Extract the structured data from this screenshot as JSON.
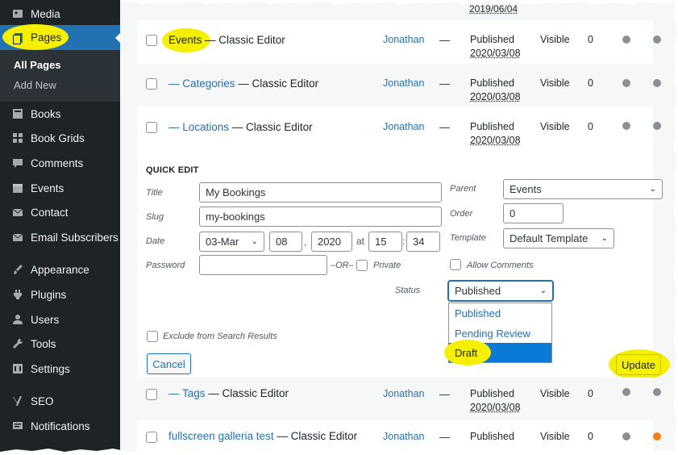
{
  "sidebar": {
    "items": [
      {
        "label": "Media",
        "icon": "media-icon"
      },
      {
        "label": "Pages",
        "icon": "pages-icon",
        "active": true
      },
      {
        "label": "Books",
        "icon": "books-icon"
      },
      {
        "label": "Book Grids",
        "icon": "grid-icon"
      },
      {
        "label": "Comments",
        "icon": "comments-icon"
      },
      {
        "label": "Events",
        "icon": "calendar-icon"
      },
      {
        "label": "Contact",
        "icon": "envelope-icon"
      },
      {
        "label": "Email Subscribers",
        "icon": "envelope-icon"
      },
      {
        "label": "Appearance",
        "icon": "brush-icon"
      },
      {
        "label": "Plugins",
        "icon": "plug-icon"
      },
      {
        "label": "Users",
        "icon": "users-icon"
      },
      {
        "label": "Tools",
        "icon": "wrench-icon"
      },
      {
        "label": "Settings",
        "icon": "settings-icon"
      },
      {
        "label": "SEO",
        "icon": "yoast-icon"
      },
      {
        "label": "Notifications",
        "icon": "bell-icon"
      }
    ],
    "submenu": {
      "all_pages": "All Pages",
      "add_new": "Add New"
    }
  },
  "top_date": "2019/06/04",
  "rows_above": [
    {
      "title": "Events",
      "suffix": " — Classic Editor",
      "author": "Jonathan",
      "comments": "—",
      "status": "Published",
      "date": "2020/03/08",
      "visibility": "Visible",
      "count": "0"
    },
    {
      "title": "— Categories",
      "suffix": " — Classic Editor",
      "author": "Jonathan",
      "comments": "—",
      "status": "Published",
      "date": "2020/03/08",
      "visibility": "Visible",
      "count": "0"
    },
    {
      "title": "— Locations",
      "suffix": " — Classic Editor",
      "author": "Jonathan",
      "comments": "—",
      "status": "Published",
      "date": "2020/03/08",
      "visibility": "Visible",
      "count": "0"
    }
  ],
  "quick_edit": {
    "heading": "QUICK EDIT",
    "title_label": "Title",
    "title_value": "My Bookings",
    "slug_label": "Slug",
    "slug_value": "my-bookings",
    "date_label": "Date",
    "date_month": "03-Mar",
    "date_day": "08",
    "date_year": "2020",
    "date_comma": ",",
    "date_at": "at",
    "date_hour": "15",
    "date_colon": ":",
    "date_minute": "34",
    "password_label": "Password",
    "password_value": "",
    "or_label": "–OR–",
    "private_label": "Private",
    "parent_label": "Parent",
    "parent_value": "Events",
    "order_label": "Order",
    "order_value": "0",
    "template_label": "Template",
    "template_value": "Default Template",
    "allow_comments_label": "Allow Comments",
    "status_label": "Status",
    "status_value": "Published",
    "status_options": [
      "Published",
      "Pending Review",
      "Draft"
    ],
    "exclude_label": "Exclude from Search Results",
    "cancel_label": "Cancel",
    "update_label": "Update"
  },
  "rows_below": [
    {
      "title": "— Tags",
      "suffix": " — Classic Editor",
      "author": "Jonathan",
      "comments": "—",
      "status": "Published",
      "date": "2020/03/08",
      "visibility": "Visible",
      "count": "0"
    },
    {
      "title": "fullscreen galleria test",
      "suffix": " — Classic Editor",
      "author": "Jonathan",
      "comments": "—",
      "status": "Published",
      "date": "",
      "visibility": "Visible",
      "count": "0"
    }
  ],
  "colors": {
    "accent": "#2271b1",
    "sidebar": "#1d2327",
    "highlight": "#f5f000",
    "seo_orange": "#f08219"
  }
}
